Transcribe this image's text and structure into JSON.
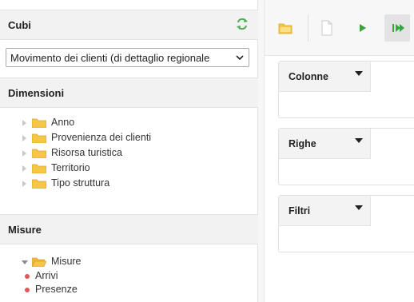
{
  "cubes": {
    "title": "Cubi",
    "refresh_icon": "refresh-icon",
    "selected_cube": "Movimento dei clienti (di dettaglio regionale"
  },
  "dimensions": {
    "title": "Dimensioni",
    "items": [
      {
        "label": "Anno"
      },
      {
        "label": "Provenienza dei clienti"
      },
      {
        "label": "Risorsa turistica"
      },
      {
        "label": "Territorio"
      },
      {
        "label": "Tipo struttura"
      }
    ]
  },
  "measures": {
    "title": "Misure",
    "folder_label": "Misure",
    "items": [
      {
        "label": "Arrivi"
      },
      {
        "label": "Presenze"
      }
    ]
  },
  "toolbar": {
    "buttons": [
      "open-folder-icon",
      "new-document-icon",
      "play-icon",
      "run-all-icon"
    ]
  },
  "drop_zones": {
    "columns": "Colonne",
    "rows": "Righe",
    "filters": "Filtri"
  },
  "colors": {
    "folder": "#f6c645",
    "measure_dot": "#e0565b",
    "play_green": "#3aa43a",
    "refresh_green": "#4caf50"
  }
}
